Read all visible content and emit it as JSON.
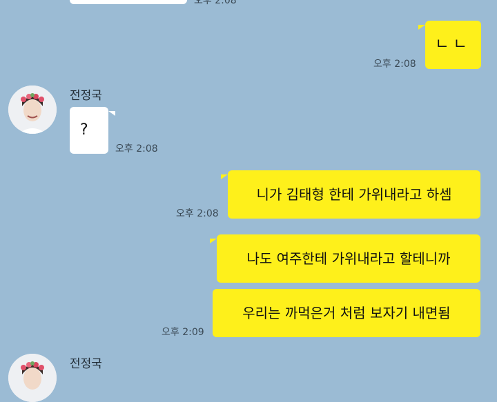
{
  "colors": {
    "background": "#9bbbd4",
    "my_bubble": "#fef01b",
    "their_bubble": "#ffffff"
  },
  "top_partial_time": "오후 2:08",
  "messages": [
    {
      "text": "ㄴㄴ",
      "time": "오후 2:08"
    },
    {
      "sender": "전정국",
      "text": "?",
      "time": "오후 2:08"
    },
    {
      "text": "니가 김태형 한테 가위내라고 하셈",
      "time": "오후 2:08"
    },
    {
      "text": "나도 여주한테 가위내라고 할테니까"
    },
    {
      "text": "우리는 까먹은거 처럼 보자기 내면됨",
      "time": "오후 2:09"
    }
  ],
  "next_sender": "전정국"
}
